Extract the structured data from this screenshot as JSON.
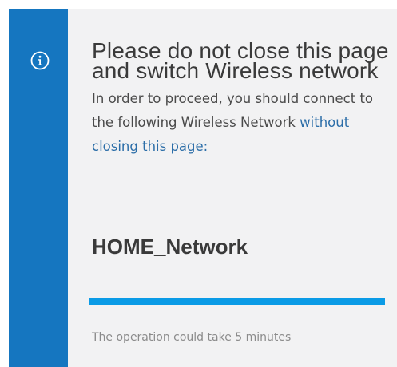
{
  "dialog": {
    "icon": "info-icon",
    "accent_color": "#1576c0",
    "title": "Please do not close this page and switch Wireless network",
    "description_prefix": "In order to proceed, you should connect to the following Wireless Network ",
    "description_highlight": "without closing this page:",
    "network_name": "HOME_Network",
    "progress": 1.0,
    "progress_color": "#0b9be6",
    "footnote": "The operation could take 5 minutes"
  }
}
